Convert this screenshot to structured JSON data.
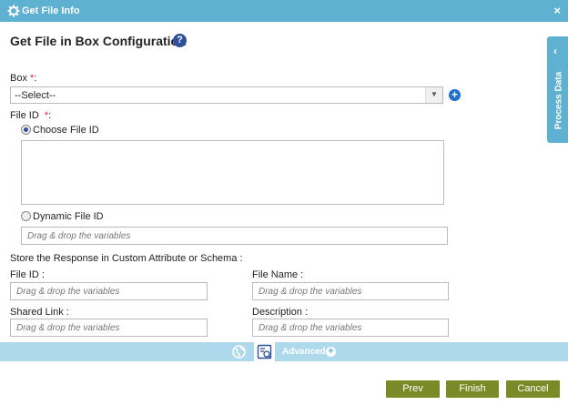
{
  "window": {
    "title": "Get File Info",
    "close_icon": "×"
  },
  "page": {
    "heading": "Get File in Box Configuration",
    "help_icon": "?"
  },
  "box": {
    "label": "Box",
    "required": "*",
    "colon": ":",
    "selected": "--Select--",
    "add_icon": "+"
  },
  "file_id": {
    "label": "File ID",
    "required": "*",
    "colon": ":",
    "choose_label": "Choose File ID",
    "dynamic_label": "Dynamic File ID",
    "dynamic_placeholder": "Drag & drop the variables",
    "selected_option": "Choose File ID"
  },
  "store": {
    "heading": "Store the Response in Custom Attribute or Schema :",
    "file_id_label": "File ID :",
    "file_id_placeholder": "Drag & drop the variables",
    "file_name_label": "File Name :",
    "file_name_placeholder": "Drag & drop the variables",
    "shared_link_label": "Shared Link :",
    "shared_link_placeholder": "Drag & drop the variables",
    "description_label": "Description :",
    "description_placeholder": "Drag & drop the variables"
  },
  "side_panel": {
    "label": "Process Data",
    "chevron": "‹"
  },
  "bottom_tabs": {
    "advanced_label": "Advanced",
    "plus_icon": "+"
  },
  "buttons": {
    "prev": "Prev",
    "finish": "Finish",
    "cancel": "Cancel"
  },
  "colors": {
    "titlebar": "#5eb1d1",
    "button": "#7a8a27",
    "help": "#2f4f9c",
    "tabbar": "#aed9ec"
  }
}
